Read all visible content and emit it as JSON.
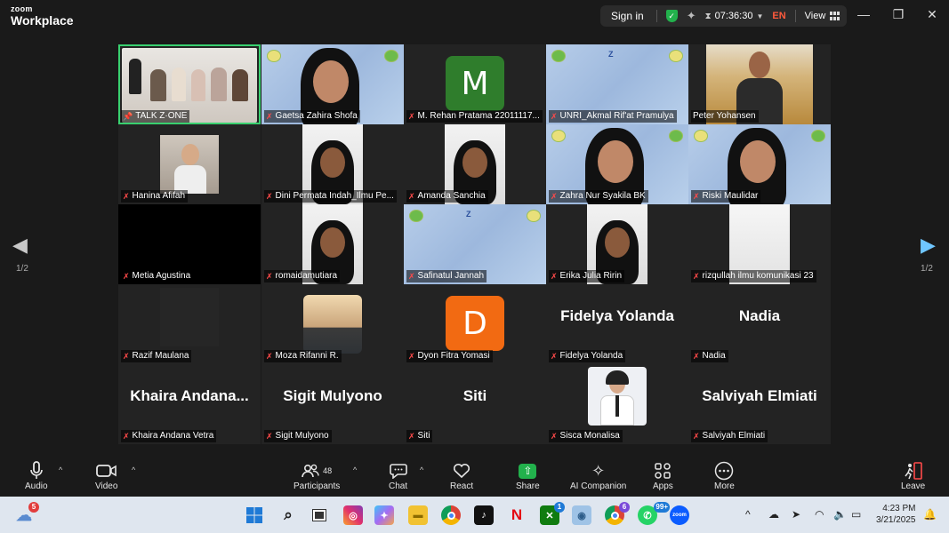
{
  "titlebar": {
    "brand_top": "zoom",
    "brand_bottom": "Workplace",
    "sign_in": "Sign in",
    "timer": "07:36:30",
    "language": "EN",
    "view": "View"
  },
  "pagination": {
    "left_label": "1/2",
    "right_label": "1/2"
  },
  "participants": [
    {
      "name": "TALK Z·ONE",
      "muted": false,
      "pinned": true,
      "kind": "video-group",
      "active": true
    },
    {
      "name": "Gaetsa Zahira Shofa",
      "muted": true,
      "kind": "video-blue"
    },
    {
      "name": "M. Rehan Pratama 22011117...",
      "muted": true,
      "kind": "avatar",
      "letter": "M",
      "color": "#2f7d2c"
    },
    {
      "name": "UNRI_Akmal Rif'at Pramulya",
      "muted": true,
      "kind": "video-blue-empty"
    },
    {
      "name": "Peter Yohansen",
      "muted": false,
      "kind": "video-field"
    },
    {
      "name": "Hanina Afifah",
      "muted": true,
      "kind": "video-small"
    },
    {
      "name": "Dini Permata Indah_Ilmu Pe...",
      "muted": true,
      "kind": "video-portrait"
    },
    {
      "name": "Amanda Sanchia",
      "muted": true,
      "kind": "video-portrait"
    },
    {
      "name": "Zahra Nur Syakila BK",
      "muted": true,
      "kind": "video-blue"
    },
    {
      "name": "Riski Maulidar",
      "muted": true,
      "kind": "video-blue"
    },
    {
      "name": "Metia Agustina",
      "muted": true,
      "kind": "black"
    },
    {
      "name": "romaidamutiara",
      "muted": true,
      "kind": "video-portrait"
    },
    {
      "name": "Safinatul Jannah",
      "muted": true,
      "kind": "video-blue-empty"
    },
    {
      "name": "Erika Julia Ririn",
      "muted": true,
      "kind": "video-portrait"
    },
    {
      "name": "rizqullah ilmu komunikasi 23",
      "muted": true,
      "kind": "video-portrait-light"
    },
    {
      "name": "Razif Maulana",
      "muted": true,
      "kind": "dark"
    },
    {
      "name": "Moza Rifanni R.",
      "muted": true,
      "kind": "video-sunset"
    },
    {
      "name": "Dyon Fitra Yomasi",
      "muted": true,
      "kind": "avatar",
      "letter": "D",
      "color": "#f26a12"
    },
    {
      "name": "Fidelya Yolanda",
      "muted": true,
      "kind": "text",
      "display": "Fidelya Yolanda"
    },
    {
      "name": "Nadia",
      "muted": true,
      "kind": "text",
      "display": "Nadia"
    },
    {
      "name": "Khaira Andana Vetra",
      "muted": true,
      "kind": "text",
      "display": "Khaira Andana..."
    },
    {
      "name": "Sigit Mulyono",
      "muted": true,
      "kind": "text",
      "display": "Sigit Mulyono"
    },
    {
      "name": "Siti",
      "muted": true,
      "kind": "text",
      "display": "Siti"
    },
    {
      "name": "Sisca Monalisa",
      "muted": true,
      "kind": "photo"
    },
    {
      "name": "Salviyah Elmiati",
      "muted": true,
      "kind": "text",
      "display": "Salviyah Elmiati"
    }
  ],
  "toolbar": {
    "audio": "Audio",
    "video": "Video",
    "participants": "Participants",
    "participants_count": "48",
    "chat": "Chat",
    "react": "React",
    "share": "Share",
    "ai_companion": "AI Companion",
    "apps": "Apps",
    "more": "More",
    "leave": "Leave"
  },
  "taskbar": {
    "weather_badge": "5",
    "xbox_badge": "1",
    "chrome_badge": "6",
    "whatsapp_badge": "99+",
    "time": "4:23 PM",
    "date": "3/21/2025"
  }
}
